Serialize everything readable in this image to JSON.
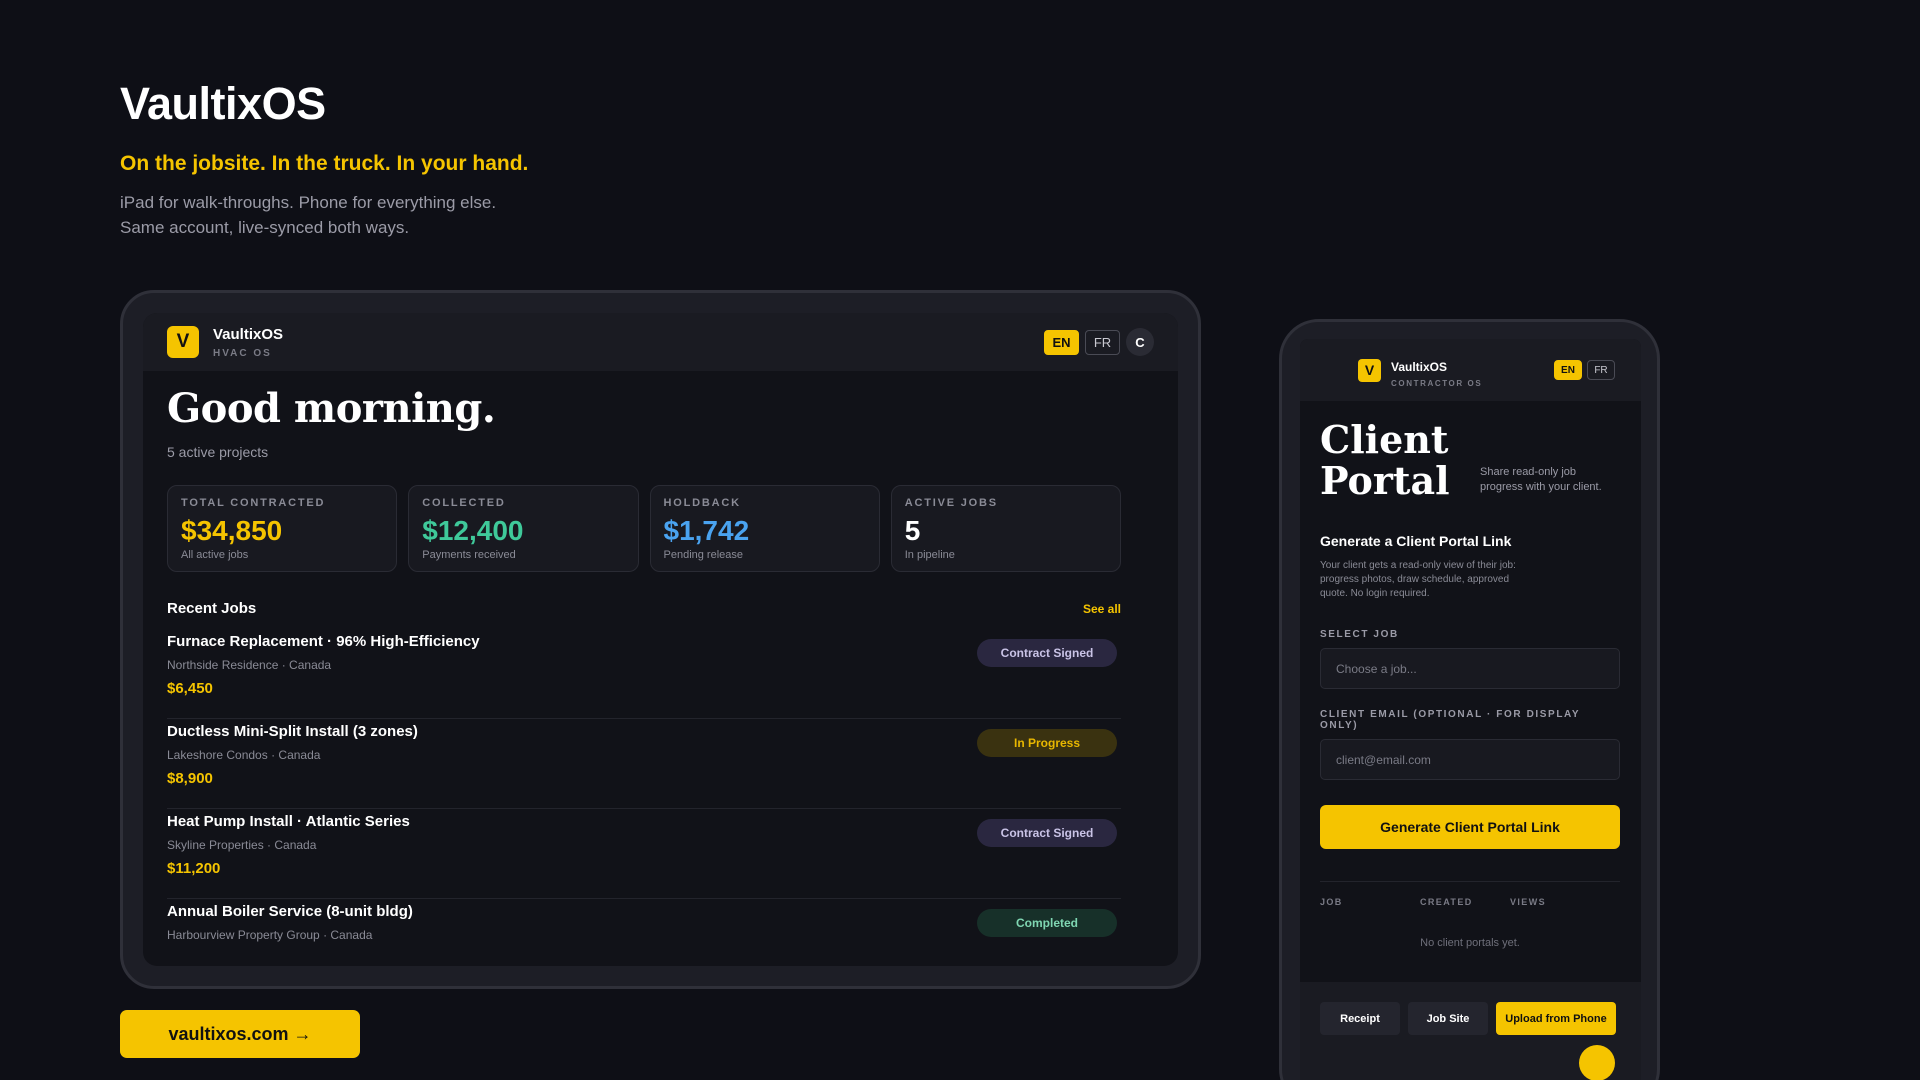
{
  "hero": {
    "title": "VaultixOS",
    "tagline": "On the jobsite. In the truck. In your hand.",
    "sub_line1": "iPad for walk-throughs. Phone for everything else.",
    "sub_line2": "Same account, live-synced both ways."
  },
  "cta": {
    "label": "vaultixos.com →"
  },
  "tablet": {
    "logo_letter": "V",
    "app_name": "VaultixOS",
    "app_sub": "HVAC OS",
    "lang": {
      "en": "EN",
      "fr": "FR",
      "user_initial": "C"
    },
    "greeting": "Good morning.",
    "active_projects": "5 active projects",
    "stats": [
      {
        "label": "TOTAL CONTRACTED",
        "value": "$34,850",
        "sub": "All active jobs",
        "color": "#f5c400"
      },
      {
        "label": "COLLECTED",
        "value": "$12,400",
        "sub": "Payments received",
        "color": "#3fc99a"
      },
      {
        "label": "HOLDBACK",
        "value": "$1,742",
        "sub": "Pending release",
        "color": "#4aa3f0"
      },
      {
        "label": "ACTIVE JOBS",
        "value": "5",
        "sub": "In pipeline",
        "color": "#ffffff"
      }
    ],
    "recent_title": "Recent Jobs",
    "see_all": "See all",
    "jobs": [
      {
        "name": "Furnace Replacement · 96% High-Efficiency",
        "location": "Northside Residence · Canada",
        "price": "$6,450",
        "status": "Contract Signed"
      },
      {
        "name": "Ductless Mini-Split Install (3 zones)",
        "location": "Lakeshore Condos · Canada",
        "price": "$8,900",
        "status": "In Progress"
      },
      {
        "name": "Heat Pump Install · Atlantic Series",
        "location": "Skyline Properties · Canada",
        "price": "$11,200",
        "status": "Contract Signed"
      },
      {
        "name": "Annual Boiler Service (8-unit bldg)",
        "location": "Harbourview Property Group · Canada",
        "price": "",
        "status": "Completed"
      }
    ]
  },
  "phone": {
    "logo_letter": "V",
    "app_name": "VaultixOS",
    "app_sub": "CONTRACTOR OS",
    "lang": {
      "en": "EN",
      "fr": "FR"
    },
    "title_line1": "Client",
    "title_line2": "Portal",
    "title_sub": "Share read-only job progress with your client.",
    "heading": "Generate a Client Portal Link",
    "description": "Your client gets a read-only view of their job: progress photos, draw schedule, approved quote. No login required.",
    "select_label": "SELECT JOB",
    "select_placeholder": "Choose a job...",
    "email_label": "CLIENT EMAIL (OPTIONAL · FOR DISPLAY ONLY)",
    "email_placeholder": "client@email.com",
    "generate_button": "Generate Client Portal Link",
    "table_cols": [
      "JOB",
      "CREATED",
      "VIEWS"
    ],
    "empty_text": "No client portals yet.",
    "actions": [
      "Receipt",
      "Job Site",
      "Upload from Phone"
    ]
  }
}
